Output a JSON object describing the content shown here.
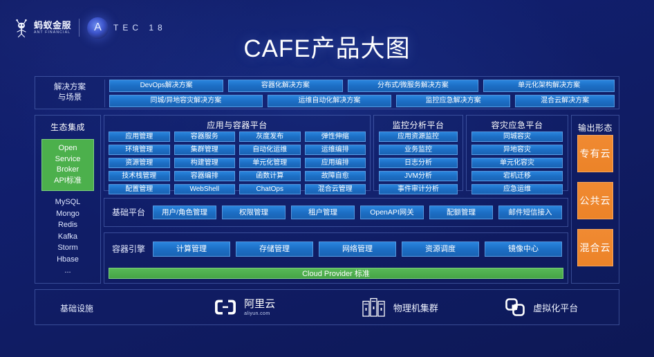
{
  "header": {
    "brand_cn": "蚂蚁金服",
    "brand_en": "ANT FINANCIAL",
    "event_mark": "A",
    "event_name": "TEC 18",
    "title": "CAFE产品大图"
  },
  "solutions": {
    "label_line1": "解决方案",
    "label_line2": "与场景",
    "row1": [
      "DevOps解决方案",
      "容器化解决方案",
      "分布式/微服务解决方案",
      "单元化架构解决方案"
    ],
    "row2": [
      "同城/异地容灾解决方案",
      "运维自动化解决方案",
      "监控应急解决方案",
      "混合云解决方案"
    ]
  },
  "ecosystem": {
    "title": "生态集成",
    "highlight": [
      "Open",
      "Service",
      "Broker",
      "API标准"
    ],
    "items": [
      "MySQL",
      "Mongo",
      "Redis",
      "Kafka",
      "Storm",
      "Hbase",
      "..."
    ]
  },
  "platform": {
    "title": "应用与容器平台",
    "items": [
      "应用管理",
      "容器服务",
      "灰度发布",
      "弹性伸缩",
      "环境管理",
      "集群管理",
      "自动化运维",
      "运维编排",
      "资源管理",
      "构建管理",
      "单元化管理",
      "应用编排",
      "技术栈管理",
      "容器编排",
      "函数计算",
      "故障自愈",
      "配置管理",
      "WebShell",
      "ChatOps",
      "混合云管理"
    ]
  },
  "monitoring": {
    "title": "监控分析平台",
    "items": [
      "应用资源监控",
      "业务监控",
      "日志分析",
      "JVM分析",
      "事件审计分析"
    ]
  },
  "disaster_recovery": {
    "title": "容灾应急平台",
    "items": [
      "同城容灾",
      "异地容灾",
      "单元化容灾",
      "宕机迁移",
      "应急运维"
    ]
  },
  "output": {
    "title": "输出形态",
    "items": [
      "专有云",
      "公共云",
      "混合云"
    ]
  },
  "base_platform": {
    "label": "基础平台",
    "items": [
      "用户/角色管理",
      "权限管理",
      "租户管理",
      "OpenAPI网关",
      "配额管理",
      "邮件短信接入"
    ]
  },
  "container_engine": {
    "label": "容器引擎",
    "items": [
      "计算管理",
      "存储管理",
      "网络管理",
      "资源调度",
      "镜像中心"
    ],
    "cloud_provider_bar": "Cloud Provider 标准"
  },
  "infrastructure": {
    "label": "基础设施",
    "items": [
      {
        "name_cn": "阿里云",
        "name_en": "aliyun.com",
        "icon": "aliyun-icon"
      },
      {
        "name_cn": "物理机集群",
        "icon": "server-rack-icon"
      },
      {
        "name_cn": "虚拟化平台",
        "icon": "vmware-icon"
      }
    ]
  },
  "colors": {
    "background_deep": "#0d1855",
    "background_mid": "#111f6e",
    "chip_blue": "#1c6ec4",
    "accent_green": "#4cb04c",
    "accent_orange": "#ec8328",
    "panel_border": "#7896e6"
  }
}
